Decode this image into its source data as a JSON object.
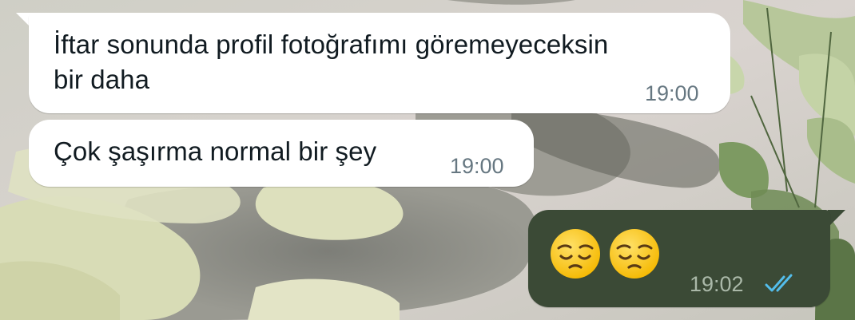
{
  "messages": [
    {
      "direction": "incoming",
      "text": "İftar sonunda profil fotoğrafımı göremeyeceksin\nbir daha",
      "time": "19:00"
    },
    {
      "direction": "incoming",
      "text": "Çok şaşırma normal bir şey",
      "time": "19:00"
    },
    {
      "direction": "outgoing",
      "emojis": [
        "pensive-face-emoji",
        "pensive-face-emoji"
      ],
      "time": "19:02",
      "status": "read"
    }
  ],
  "colors": {
    "incoming_bubble": "#ffffff",
    "outgoing_bubble": "#3b4a36",
    "read_ticks": "#53bdeb"
  }
}
